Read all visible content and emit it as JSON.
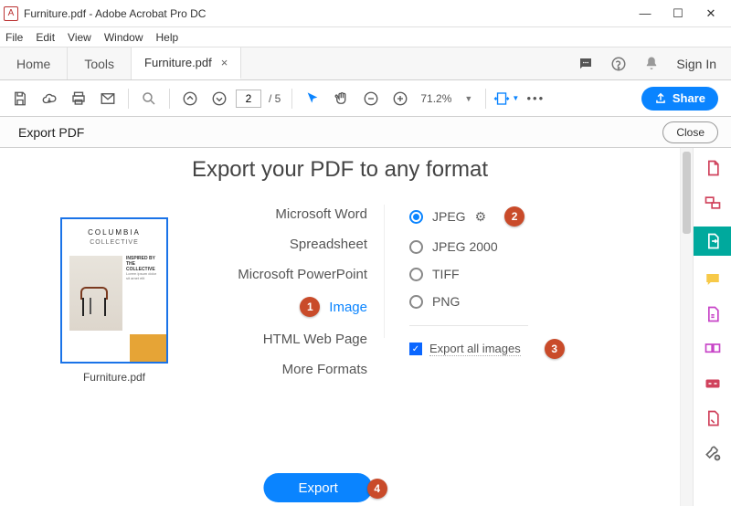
{
  "titlebar": {
    "app_icon_letter": "A",
    "title": "Furniture.pdf - Adobe Acrobat Pro DC"
  },
  "menu": {
    "file": "File",
    "edit": "Edit",
    "view": "View",
    "window": "Window",
    "help": "Help"
  },
  "tabs": {
    "home": "Home",
    "tools": "Tools",
    "file": "Furniture.pdf"
  },
  "topright": {
    "signin": "Sign In"
  },
  "toolbar": {
    "page_current": "2",
    "page_total": "/ 5",
    "zoom": "71.2%",
    "share": "Share"
  },
  "panel": {
    "title": "Export PDF",
    "close": "Close"
  },
  "main": {
    "heading": "Export your PDF to any format",
    "thumb": {
      "brand1": "COLUMBIA",
      "brand2": "COLLECTIVE",
      "tag1": "INSPIRED BY",
      "tag2": "THE COLLECTIVE",
      "name": "Furniture.pdf"
    },
    "categories": {
      "word": "Microsoft Word",
      "spreadsheet": "Spreadsheet",
      "ppt": "Microsoft PowerPoint",
      "image": "Image",
      "html": "HTML Web Page",
      "more": "More Formats"
    },
    "options": {
      "jpeg": "JPEG",
      "jpeg2000": "JPEG 2000",
      "tiff": "TIFF",
      "png": "PNG",
      "export_all": "Export all images"
    },
    "export_btn": "Export"
  },
  "badges": {
    "b1": "1",
    "b2": "2",
    "b3": "3",
    "b4": "4"
  }
}
